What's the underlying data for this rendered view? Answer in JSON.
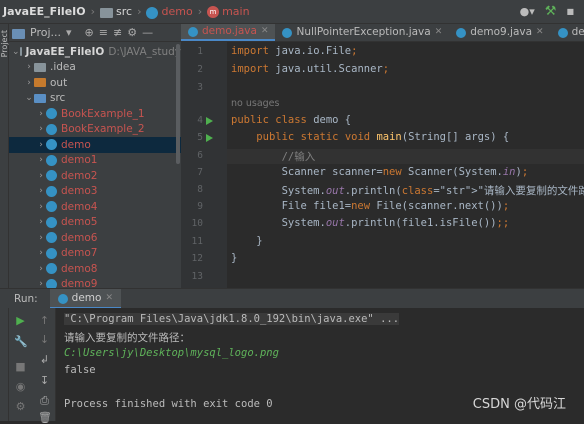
{
  "breadcrumb": {
    "project": "JavaEE_FileIO",
    "folder": "src",
    "class": "demo",
    "method": "main"
  },
  "icons": {
    "user": "user-icon",
    "build": "hammer-icon",
    "search": "search-icon"
  },
  "sidebar": {
    "label": "Project"
  },
  "project_panel": {
    "title": "Proj...",
    "tree": [
      {
        "label": "JavaEE_FileIO",
        "extra": "D:\\JAVA_study",
        "type": "root",
        "indent": 0,
        "expanded": true
      },
      {
        "label": ".idea",
        "type": "folder",
        "indent": 1,
        "expanded": false
      },
      {
        "label": "out",
        "type": "folder-orange",
        "indent": 1,
        "expanded": false
      },
      {
        "label": "src",
        "type": "folder-blue",
        "indent": 1,
        "expanded": true
      },
      {
        "label": "BookExample_1",
        "type": "package-red",
        "indent": 2
      },
      {
        "label": "BookExample_2",
        "type": "package-red",
        "indent": 2
      },
      {
        "label": "demo",
        "type": "package-red",
        "indent": 2,
        "selected": true
      },
      {
        "label": "demo1",
        "type": "package-red",
        "indent": 2
      },
      {
        "label": "demo2",
        "type": "package-red",
        "indent": 2
      },
      {
        "label": "demo3",
        "type": "package-red",
        "indent": 2
      },
      {
        "label": "demo4",
        "type": "package-red",
        "indent": 2
      },
      {
        "label": "demo5",
        "type": "package-red",
        "indent": 2
      },
      {
        "label": "demo6",
        "type": "package-red",
        "indent": 2
      },
      {
        "label": "demo7",
        "type": "package-red",
        "indent": 2
      },
      {
        "label": "demo8",
        "type": "package-red",
        "indent": 2
      },
      {
        "label": "demo9",
        "type": "package-red",
        "indent": 2
      }
    ]
  },
  "tabs": [
    {
      "label": "demo.java",
      "active": true
    },
    {
      "label": "NullPointerException.java",
      "active": false
    },
    {
      "label": "demo9.java",
      "active": false
    },
    {
      "label": "demo10.ja",
      "active": false
    }
  ],
  "editor": {
    "line_numbers": [
      "1",
      "2",
      "3",
      "4",
      "5",
      "6",
      "7",
      "8",
      "9",
      "10",
      "11",
      "12",
      "13"
    ],
    "usage_hint": "no usages",
    "lines": [
      "import java.io.File;",
      "import java.util.Scanner;",
      "",
      "public class demo {",
      "    public static void main(String[] args) {",
      "        //输入",
      "        Scanner scanner=new Scanner(System.in);",
      "        System.out.println(\"请输入要复制的文件路径：\");",
      "        File file1=new File(scanner.next());",
      "        System.out.println(file1.isFile());;",
      "    }",
      "}",
      ""
    ]
  },
  "run": {
    "label": "Run:",
    "tab": "demo",
    "console": [
      "\"C:\\Program Files\\Java\\jdk1.8.0_192\\bin\\java.exe\" ...",
      "请输入要复制的文件路径：",
      "C:\\Users\\jy\\Desktop\\mysql_logo.png",
      "false",
      "",
      "Process finished with exit code 0"
    ]
  },
  "watermark": "CSDN @代码江"
}
